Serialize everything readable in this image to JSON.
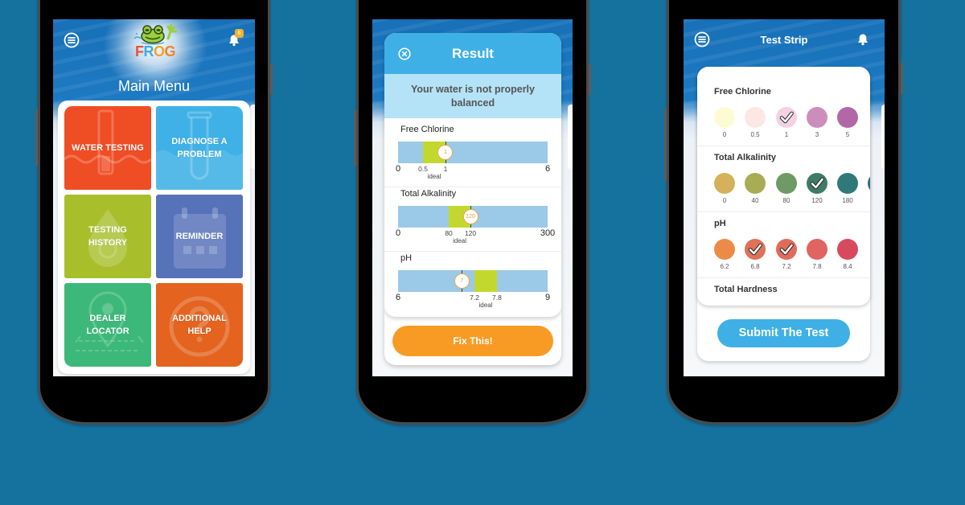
{
  "background_color": "#15729f",
  "main_menu": {
    "header": {
      "menu_icon": "hamburger-icon",
      "notification_icon": "bell-icon",
      "notification_count": "6",
      "logo": {
        "letters": [
          "F",
          "R",
          "O",
          "G"
        ],
        "letter_colors": [
          "#ef4f3a",
          "#41a9e6",
          "#f6a11f",
          "#f0842a"
        ]
      },
      "title": "Main Menu"
    },
    "tiles": [
      {
        "label_lines": [
          "WATER TESTING"
        ],
        "color": "#ef4d24",
        "icon": "test-strip-icon"
      },
      {
        "label_lines": [
          "DIAGNOSE A",
          "PROBLEM"
        ],
        "color": "#3fb1e6",
        "icon": "test-tube-icon"
      },
      {
        "label_lines": [
          "TESTING",
          "HISTORY"
        ],
        "color": "#a8bf2b",
        "icon": "water-drop-icon"
      },
      {
        "label_lines": [
          "REMINDER"
        ],
        "color": "#5672b9",
        "icon": "calendar-icon"
      },
      {
        "label_lines": [
          "DEALER",
          "LOCATOR"
        ],
        "color": "#3cb87a",
        "icon": "map-pin-icon"
      },
      {
        "label_lines": [
          "ADDITIONAL",
          "HELP"
        ],
        "color": "#e3631f",
        "icon": "question-circle-icon"
      }
    ]
  },
  "result": {
    "title": "Result",
    "close_icon": "close-circle-icon",
    "message": "Your water is not properly balanced",
    "gauges": [
      {
        "name": "Free Chlorine",
        "min": 0,
        "max": 6,
        "ideal_low": 0.5,
        "ideal_high": 1,
        "value": 1,
        "min_label": "0",
        "max_label": "6",
        "ideal_low_label": "0.5",
        "ideal_high_label": "1",
        "value_label": "1",
        "ideal_label": "ideal"
      },
      {
        "name": "Total Alkalinity",
        "min": 0,
        "max": 300,
        "ideal_low": 80,
        "ideal_high": 120,
        "value": 120,
        "min_label": "0",
        "max_label": "300",
        "ideal_low_label": "80",
        "ideal_high_label": "120",
        "value_label": "120",
        "ideal_label": "ideal"
      },
      {
        "name": "pH",
        "min": 6,
        "max": 9,
        "ideal_low": 7.2,
        "ideal_high": 7.8,
        "value": 7,
        "min_label": "6",
        "max_label": "9",
        "ideal_low_label": "7.2",
        "ideal_high_label": "7.8",
        "value_label": "7",
        "ideal_label": "ideal"
      }
    ],
    "colors": {
      "header": "#3fb0e5",
      "ideal_zone": "#c3d82f",
      "bar": "#9bc9e8"
    },
    "fix_button": "Fix This!"
  },
  "test_strip": {
    "title": "Test Strip",
    "menu_icon": "hamburger-icon",
    "notification_icon": "bell-icon",
    "sections": [
      {
        "name": "Free Chlorine",
        "swatches": [
          {
            "label": "0",
            "color": "#fdfbd4",
            "selected": false
          },
          {
            "label": "0.5",
            "color": "#fde7e5",
            "selected": false
          },
          {
            "label": "1",
            "color": "#f4d2e3",
            "selected": true
          },
          {
            "label": "3",
            "color": "#cc8dbd",
            "selected": false
          },
          {
            "label": "5",
            "color": "#b267a7",
            "selected": false
          }
        ]
      },
      {
        "name": "Total Alkalinity",
        "swatches": [
          {
            "label": "0",
            "color": "#d4b15a",
            "selected": false
          },
          {
            "label": "40",
            "color": "#a8ac54",
            "selected": false
          },
          {
            "label": "80",
            "color": "#6e9a63",
            "selected": false
          },
          {
            "label": "120",
            "color": "#3f7b66",
            "selected": true
          },
          {
            "label": "180",
            "color": "#2f7a78",
            "selected": false
          },
          {
            "color": "#2c6e78",
            "selected": false
          }
        ]
      },
      {
        "name": "pH",
        "swatches": [
          {
            "label": "6.2",
            "color": "#ec8b48",
            "selected": false
          },
          {
            "label": "6.8",
            "color": "#e0725a",
            "selected": true
          },
          {
            "label": "7.2",
            "color": "#e06b5a",
            "selected": true
          },
          {
            "label": "7.8",
            "color": "#e16362",
            "selected": false
          },
          {
            "label": "8.4",
            "color": "#d8495e",
            "selected": false
          }
        ]
      },
      {
        "name": "Total Hardness",
        "swatches": []
      }
    ],
    "submit_button": "Submit The Test"
  }
}
